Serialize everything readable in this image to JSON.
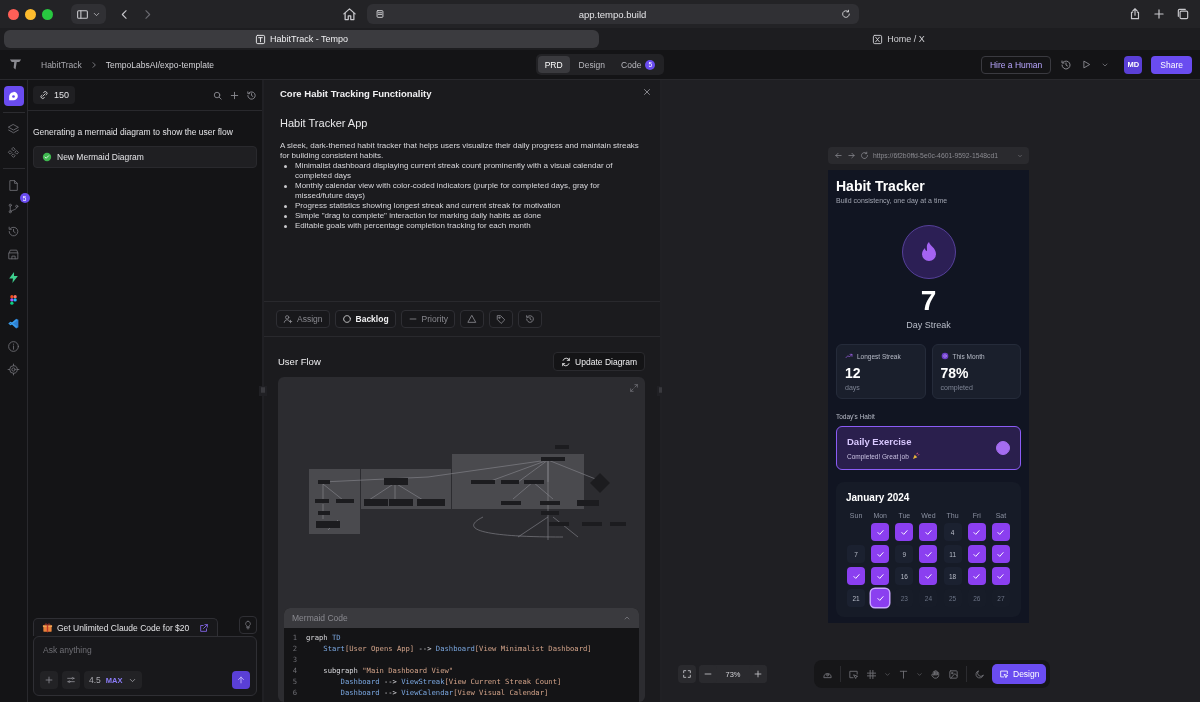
{
  "browser": {
    "url": "app.tempo.build",
    "tabs": [
      {
        "title": "HabitTrack - Tempo",
        "selected": true
      },
      {
        "title": "Home / X",
        "selected": false
      }
    ]
  },
  "header": {
    "breadcrumb": [
      "HabitTrack",
      "TempoLabsAI/expo-template"
    ],
    "view_tabs": [
      {
        "label": "PRD",
        "selected": true
      },
      {
        "label": "Design",
        "selected": false
      },
      {
        "label": "Code",
        "selected": false,
        "badge": "5"
      }
    ],
    "hire_button": "Hire a Human",
    "avatar": "MD",
    "share_button": "Share"
  },
  "rail": [
    {
      "selected": true
    },
    {
      "selected": false
    },
    {
      "selected": false
    },
    {
      "selected": false
    },
    {
      "selected": false,
      "badge": "5"
    },
    {
      "selected": false
    },
    {
      "selected": false
    },
    {
      "selected": false
    },
    {
      "selected": false
    },
    {
      "selected": false
    },
    {
      "selected": false
    },
    {
      "selected": false
    }
  ],
  "chat": {
    "credits": "150",
    "status": "Generating a mermaid diagram to show the user flow",
    "steps": [
      {
        "label": "New Mermaid Diagram",
        "done": true
      }
    ],
    "promo": "Get Unlimited Claude Code for $20",
    "placeholder": "Ask anything",
    "model": "4.5",
    "model_tag": "MAX"
  },
  "prd": {
    "title": "Core Habit Tracking Functionality",
    "heading": "Habit Tracker App",
    "intro": "A sleek, dark-themed habit tracker that helps users visualize their daily progress and maintain streaks for building consistent habits.",
    "bullets": [
      "Minimalist dashboard displaying current streak count prominently with a visual calendar of completed days",
      "Monthly calendar view with color-coded indicators (purple for completed days, gray for missed/future days)",
      "Progress statistics showing longest streak and current streak for motivation",
      "Simple \"drag to complete\" interaction for marking daily habits as done",
      "Editable goals with percentage completion tracking for each month"
    ],
    "actions": [
      {
        "label": "Assign",
        "emphasis": false
      },
      {
        "label": "Backlog",
        "emphasis": true
      },
      {
        "label": "Priority",
        "emphasis": false
      }
    ]
  },
  "user_flow": {
    "title": "User Flow",
    "update_button": "Update Diagram",
    "code": {
      "title": "Mermaid Code",
      "expanded": true,
      "lines": [
        {
          "number": "1",
          "tokens": [
            {
              "text": "graph ",
              "kind": "plain"
            },
            {
              "text": "TD",
              "kind": "node"
            }
          ]
        },
        {
          "number": "2",
          "tokens": [
            {
              "text": "    Start",
              "kind": "node"
            },
            {
              "text": "[User Opens App]",
              "kind": "label"
            },
            {
              "text": " --> ",
              "kind": "plain"
            },
            {
              "text": "Dashboard",
              "kind": "node"
            },
            {
              "text": "[View Minimalist Dashboard]",
              "kind": "label"
            }
          ]
        },
        {
          "number": "3"
        },
        {
          "number": "4",
          "tokens": [
            {
              "text": "    subgraph ",
              "kind": "plain"
            },
            {
              "text": "\"Main Dashboard View\"",
              "kind": "label"
            }
          ]
        },
        {
          "number": "5",
          "tokens": [
            {
              "text": "        Dashboard",
              "kind": "node"
            },
            {
              "text": " --> ",
              "kind": "plain"
            },
            {
              "text": "ViewStreak",
              "kind": "node"
            },
            {
              "text": "[View Current Streak Count]",
              "kind": "label"
            }
          ]
        },
        {
          "number": "6",
          "tokens": [
            {
              "text": "        Dashboard",
              "kind": "node"
            },
            {
              "text": " --> ",
              "kind": "plain"
            },
            {
              "text": "ViewCalendar",
              "kind": "node"
            },
            {
              "text": "[View Visual Calendar]",
              "kind": "label"
            }
          ]
        }
      ]
    }
  },
  "preview": {
    "url": "https://6f2b0ffd-5e0c-4601-9592-1548cd1",
    "app": {
      "title": "Habit Tracker",
      "subtitle": "Build consistency, one day at a time",
      "streak": "7",
      "streak_label": "Day Streak",
      "stats": [
        {
          "label": "Longest Streak",
          "value": "12",
          "unit": "days"
        },
        {
          "label": "This Month",
          "value": "78%",
          "unit": "completed"
        }
      ],
      "section": "Today's Habit",
      "habit": {
        "name": "Daily Exercise",
        "note": "Completed! Great job",
        "completed": true
      },
      "calendar": {
        "month": "January 2024",
        "weekdays": [
          "Sun",
          "Mon",
          "Tue",
          "Wed",
          "Thu",
          "Fri",
          "Sat"
        ],
        "weeks": [
          [
            {
              "kind": "blank"
            },
            {
              "kind": "done"
            },
            {
              "kind": "done"
            },
            {
              "kind": "done"
            },
            {
              "label": "4",
              "kind": "open"
            },
            {
              "kind": "done"
            },
            {
              "kind": "done"
            }
          ],
          [
            {
              "label": "7",
              "kind": "open"
            },
            {
              "kind": "done"
            },
            {
              "label": "9",
              "kind": "open"
            },
            {
              "kind": "done"
            },
            {
              "label": "11",
              "kind": "open"
            },
            {
              "kind": "done"
            },
            {
              "kind": "done"
            }
          ],
          [
            {
              "kind": "done"
            },
            {
              "kind": "done"
            },
            {
              "label": "16",
              "kind": "open"
            },
            {
              "kind": "done"
            },
            {
              "label": "18",
              "kind": "open"
            },
            {
              "kind": "done"
            },
            {
              "kind": "done"
            }
          ],
          [
            {
              "label": "21",
              "kind": "open"
            },
            {
              "kind": "today"
            },
            {
              "label": "23",
              "kind": "future"
            },
            {
              "label": "24",
              "kind": "future"
            },
            {
              "label": "25",
              "kind": "future"
            },
            {
              "label": "26",
              "kind": "future"
            },
            {
              "label": "27",
              "kind": "future"
            }
          ]
        ]
      }
    }
  },
  "zoom": "73%",
  "toolbar": {
    "design_button": "Design",
    "design_selected": true
  }
}
